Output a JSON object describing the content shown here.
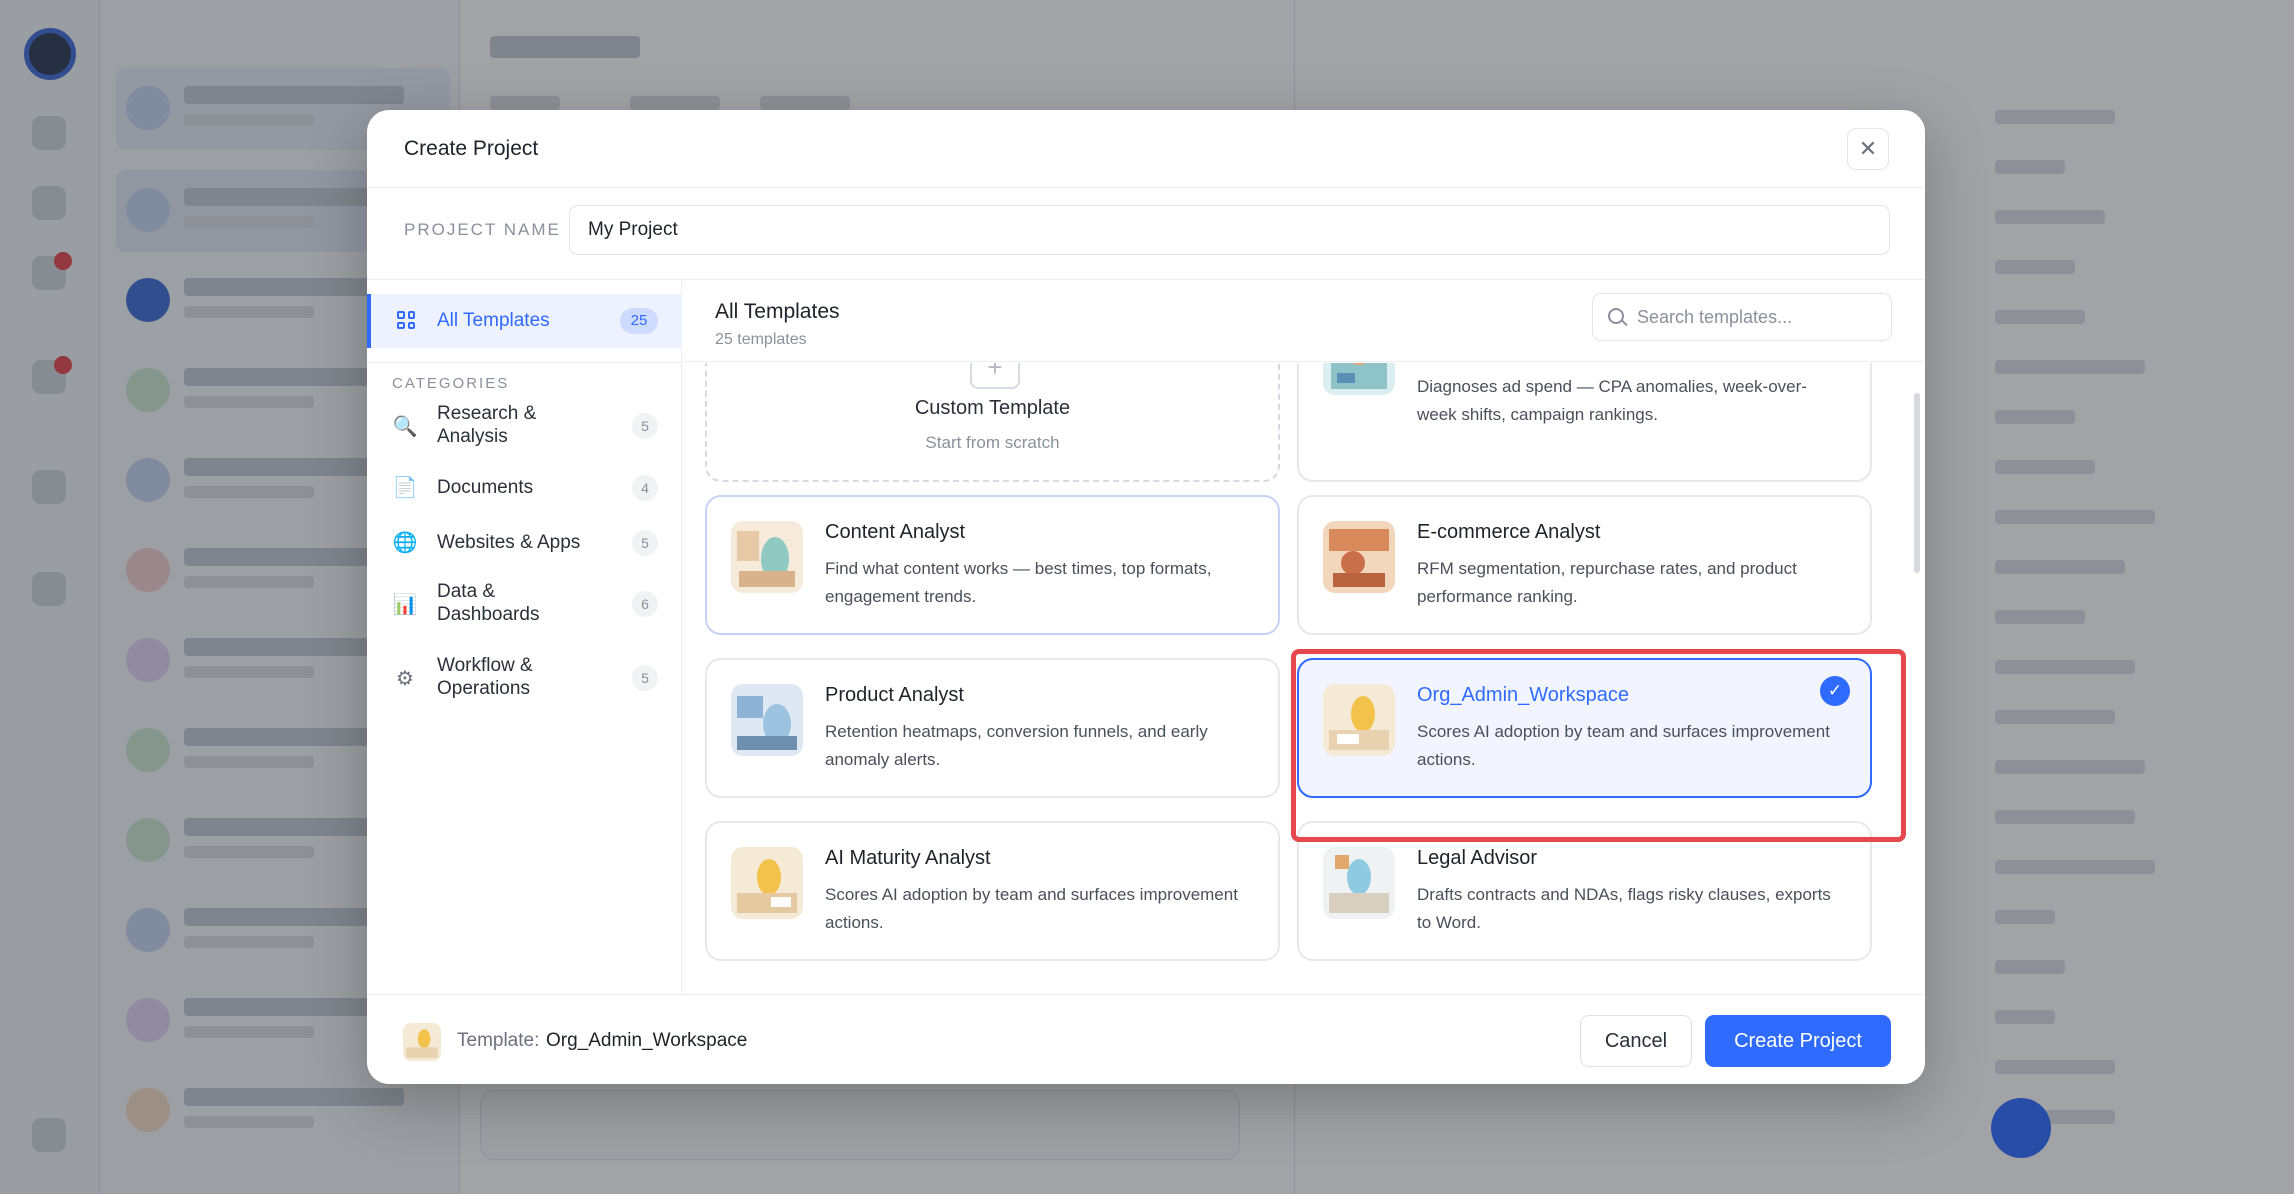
{
  "modal": {
    "title": "Create Project",
    "close_icon": "close-icon"
  },
  "project_name": {
    "label": "PROJECT NAME",
    "value": "My Project"
  },
  "sidebar": {
    "all_templates": {
      "label": "All Templates",
      "count": "25",
      "icon": "grid-icon"
    },
    "categories_heading": "CATEGORIES",
    "categories": [
      {
        "label": "Research & Analysis",
        "count": "5",
        "icon": "magnifier-icon",
        "glyph": "🔍"
      },
      {
        "label": "Documents",
        "count": "4",
        "icon": "document-icon",
        "glyph": "📄"
      },
      {
        "label": "Websites & Apps",
        "count": "5",
        "icon": "globe-icon",
        "glyph": "🌐"
      },
      {
        "label": "Data & Dashboards",
        "count": "6",
        "icon": "bar-chart-icon",
        "glyph": "📊"
      },
      {
        "label": "Workflow & Operations",
        "count": "5",
        "icon": "gear-icon",
        "glyph": "⚙"
      }
    ]
  },
  "content": {
    "title": "All Templates",
    "subtitle": "25 templates",
    "search_placeholder": "Search templates..."
  },
  "templates": {
    "custom": {
      "name": "Custom Template",
      "desc": "Start from scratch",
      "icon": "plus-icon"
    },
    "ads": {
      "desc": "Diagnoses ad spend — CPA anomalies, week-over-week shifts, campaign rankings."
    },
    "content_analyst": {
      "name": "Content Analyst",
      "desc": "Find what content works — best times, top formats, engagement trends."
    },
    "ecommerce": {
      "name": "E-commerce Analyst",
      "desc": "RFM segmentation, repurchase rates, and product performance ranking."
    },
    "product": {
      "name": "Product Analyst",
      "desc": "Retention heatmaps, conversion funnels, and early anomaly alerts."
    },
    "org_admin": {
      "name": "Org_Admin_Workspace",
      "desc": "Scores AI adoption by team and surfaces improvement actions.",
      "selected": true
    },
    "ai_maturity": {
      "name": "AI Maturity Analyst",
      "desc": "Scores AI adoption by team and surfaces improvement actions."
    },
    "legal": {
      "name": "Legal Advisor",
      "desc": "Drafts contracts and NDAs, flags risky clauses, exports to Word."
    }
  },
  "footer": {
    "template_label": "Template:",
    "template_value": "Org_Admin_Workspace",
    "cancel": "Cancel",
    "create": "Create Project"
  },
  "colors": {
    "accent": "#2f6bff",
    "highlight": "#e5484d"
  }
}
